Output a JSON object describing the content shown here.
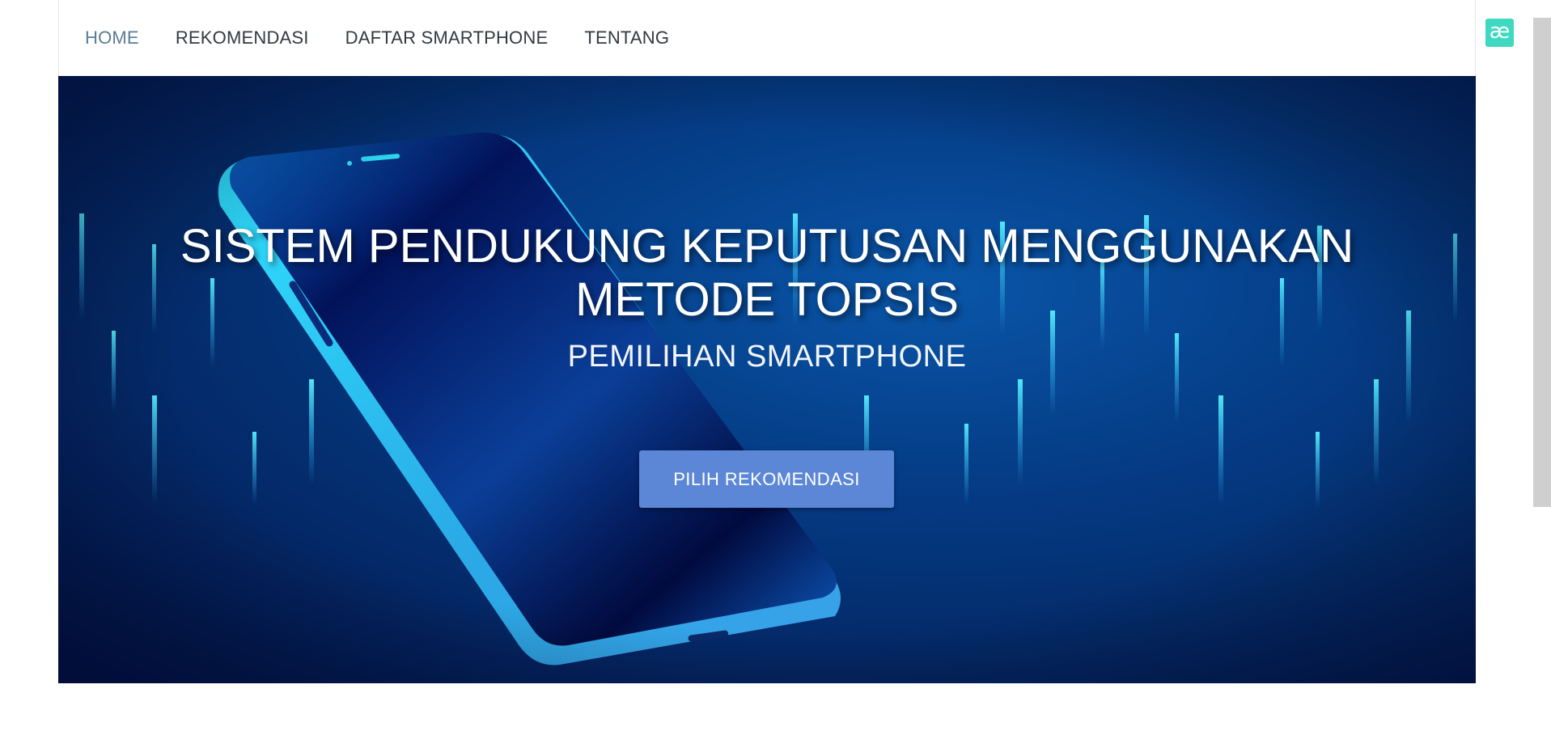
{
  "nav": {
    "items": [
      {
        "label": "HOME",
        "active": true
      },
      {
        "label": "REKOMENDASI",
        "active": false
      },
      {
        "label": "DAFTAR SMARTPHONE",
        "active": false
      },
      {
        "label": "TENTANG",
        "active": false
      }
    ]
  },
  "hero": {
    "title_line1": "SISTEM PENDUKUNG KEPUTUSAN MENGGUNAKAN",
    "title_line2": "METODE TOPSIS",
    "subtitle": "PEMILIHAN SMARTPHONE",
    "button_label": "PILIH REKOMENDASI"
  },
  "extension": {
    "icon": "ae-ligature-icon",
    "glyph": "æ"
  },
  "colors": {
    "nav_active": "#5a7d94",
    "nav_text": "#333a40",
    "button": "#5b87d6",
    "hero_dark": "#03124a",
    "hero_mid": "#053f8a",
    "phone_edge": "#2fd4f5",
    "extension": "#3fd9c2"
  }
}
